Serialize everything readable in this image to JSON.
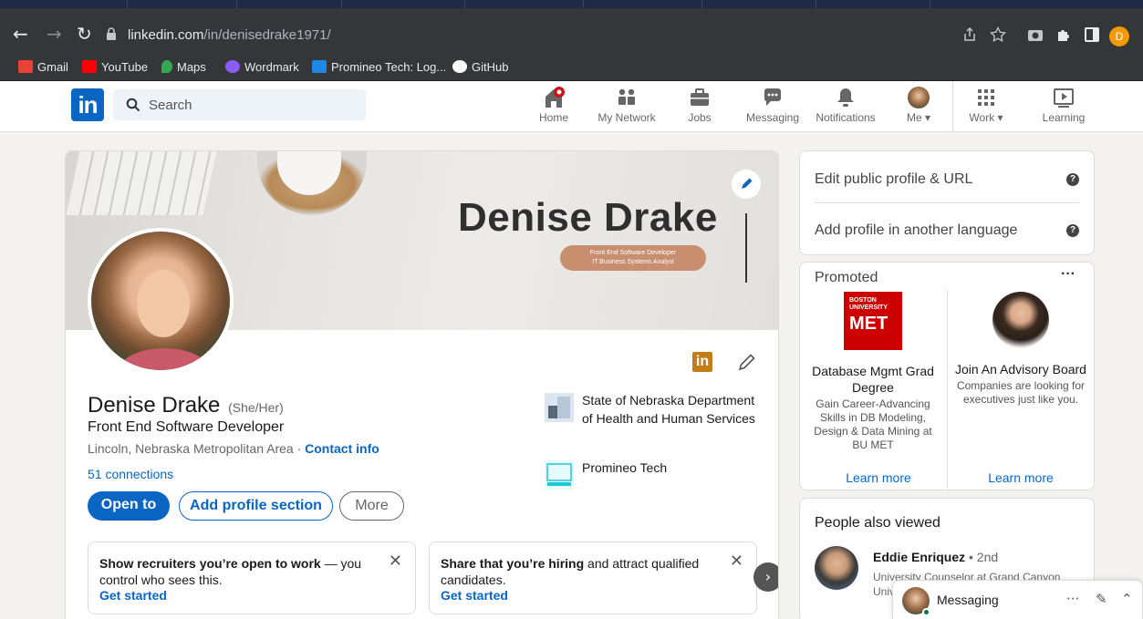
{
  "browser": {
    "url_host": "linkedin.com",
    "url_path": "/in/denisedrake1971/",
    "profile_initial": "D",
    "bookmarks": [
      {
        "label": "Gmail",
        "color": "#ea4335"
      },
      {
        "label": "YouTube",
        "color": "#ff0000"
      },
      {
        "label": "Maps",
        "color": "#34a853"
      },
      {
        "label": "Wordmark",
        "color": "#8a5cf6"
      },
      {
        "label": "Promineo Tech: Log...",
        "color": "#1e88e5"
      },
      {
        "label": "GitHub",
        "color": "#ffffff"
      }
    ]
  },
  "linkedin_nav": {
    "search_placeholder": "Search",
    "items": [
      {
        "label": "Home"
      },
      {
        "label": "My Network"
      },
      {
        "label": "Jobs"
      },
      {
        "label": "Messaging"
      },
      {
        "label": "Notifications"
      },
      {
        "label": "Me ▾"
      },
      {
        "label": "Work ▾"
      },
      {
        "label": "Learning"
      }
    ]
  },
  "banner": {
    "name": "Denise Drake",
    "pill_line1": "Front End Software Developer",
    "pill_line2": "IT Business Systems Analyst"
  },
  "profile": {
    "name": "Denise Drake",
    "pronouns": "(She/Her)",
    "headline": "Front End Software Developer",
    "location": "Lincoln, Nebraska Metropolitan Area · ",
    "contact_info": "Contact info",
    "connections": "51 connections",
    "buttons": {
      "open_to": "Open to",
      "add_section": "Add profile section",
      "more": "More"
    },
    "li_badge": "in",
    "orgs": [
      {
        "name": "State of Nebraska Department of Health and Human Services"
      },
      {
        "name": "Promineo Tech"
      }
    ],
    "cards": [
      {
        "bold": "Show recruiters you’re open to work",
        "rest": " — you control who sees this.",
        "cta": "Get started"
      },
      {
        "bold": "Share that you’re hiring",
        "rest": " and attract qualified candidates.",
        "cta": "Get started"
      }
    ]
  },
  "sidebar": {
    "edit_url": "Edit public profile & URL",
    "add_language": "Add profile in another language",
    "help_glyph": "?"
  },
  "promoted": {
    "title": "Promoted",
    "menu": "···",
    "ads": [
      {
        "logo_small": "BOSTON UNIVERSITY",
        "logo_big": "MET",
        "title": "Database Mgmt Grad Degree",
        "desc": "Gain Career-Advancing Skills in DB Modeling, Design & Data Mining at BU MET",
        "cta": "Learn more"
      },
      {
        "title": "Join An Advisory Board",
        "desc": "Companies are looking for executives just like you.",
        "cta": "Learn more"
      }
    ]
  },
  "people_also_viewed": {
    "title": "People also viewed",
    "person_name": "Eddie Enriquez",
    "person_degree": " • 2nd",
    "person_sub": "University Counselor at Grand Canyon Univ..."
  },
  "messaging": {
    "label": "Messaging"
  }
}
